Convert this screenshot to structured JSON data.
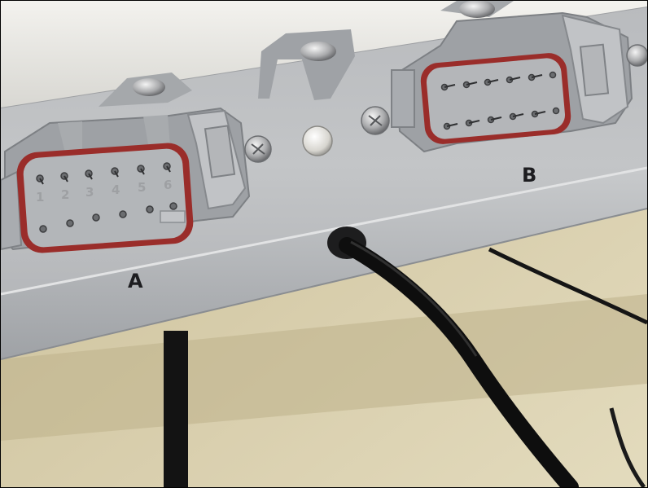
{
  "photo": {
    "subject_note": "",
    "labels": {
      "connector_a": "A",
      "connector_b": "B"
    },
    "pin_numbers_a": [
      "1",
      "2",
      "3",
      "4",
      "5",
      "6"
    ],
    "colors": {
      "housing": "#b8babd",
      "connector": "#9c9fa3",
      "seal": "#9a2d2a",
      "cable": "#121212",
      "floor": "#d8ceac"
    }
  }
}
